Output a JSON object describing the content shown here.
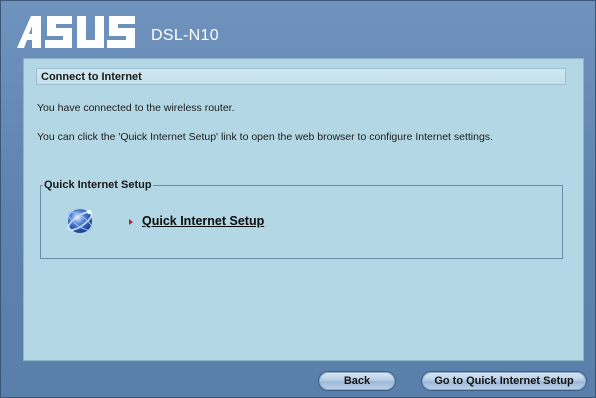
{
  "header": {
    "brand": "ASUS",
    "model": "DSL-N10"
  },
  "panel": {
    "section_title": "Connect to Internet",
    "message_connected": "You have connected to the wireless router.",
    "message_instructions": "You can click the 'Quick Internet Setup' link to open the web browser to configure Internet settings."
  },
  "quick_setup": {
    "group_label": "Quick Internet Setup",
    "link_label": "Quick Internet Setup",
    "icon": "globe-icon",
    "arrow_icon": "arrow-right-icon",
    "arrow_color": "#b5242f"
  },
  "footer": {
    "back_label": "Back",
    "go_label": "Go to Quick Internet Setup"
  },
  "colors": {
    "window_bg": "#5d82ae",
    "panel_bg": "#b3d7e5"
  }
}
